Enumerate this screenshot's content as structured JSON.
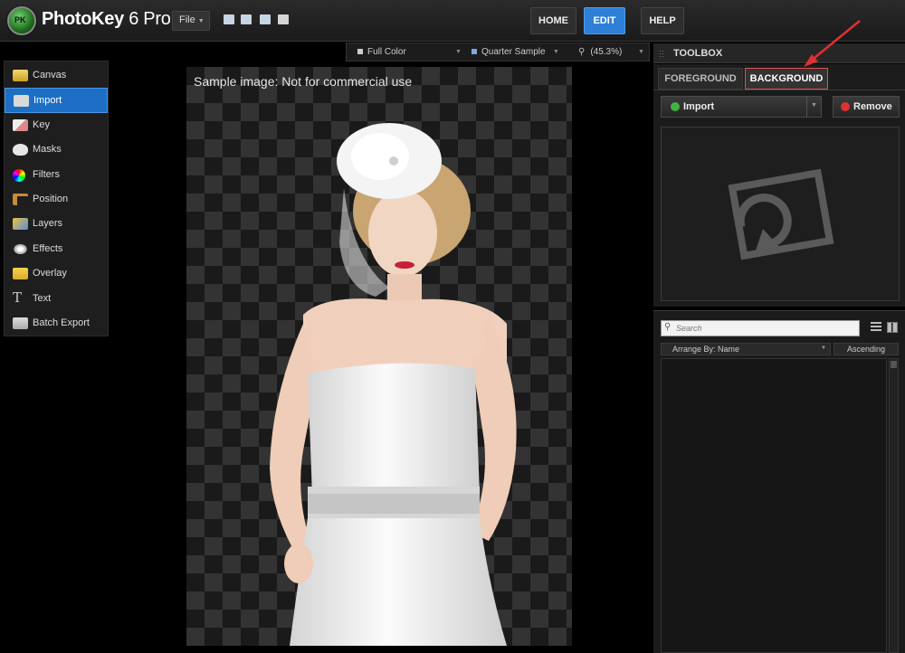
{
  "app": {
    "logo_text": "PK",
    "title": "PhotoKey",
    "version": "6 Pro"
  },
  "topbar": {
    "file_label": "File",
    "nav": [
      {
        "label": "HOME"
      },
      {
        "label": "EDIT"
      },
      {
        "label": "HELP"
      }
    ],
    "active_nav": "EDIT"
  },
  "sidebar": {
    "items": [
      {
        "label": "Canvas",
        "icon": "canvas-icon"
      },
      {
        "label": "Import",
        "icon": "import-icon"
      },
      {
        "label": "Key",
        "icon": "key-icon"
      },
      {
        "label": "Masks",
        "icon": "masks-icon"
      },
      {
        "label": "Filters",
        "icon": "filters-icon"
      },
      {
        "label": "Position",
        "icon": "position-icon"
      },
      {
        "label": "Layers",
        "icon": "layers-icon"
      },
      {
        "label": "Effects",
        "icon": "effects-icon"
      },
      {
        "label": "Overlay",
        "icon": "overlay-icon"
      },
      {
        "label": "Text",
        "icon": "text-icon"
      },
      {
        "label": "Batch Export",
        "icon": "batch-export-icon"
      }
    ],
    "active": "Import"
  },
  "canvas": {
    "color_mode": "Full Color",
    "sample_mode": "Quarter Sample",
    "zoom": "(45.3%)",
    "watermark": "Sample image: Not for commercial use"
  },
  "toolbox": {
    "title": "TOOLBOX",
    "tabs": [
      {
        "label": "FOREGROUND"
      },
      {
        "label": "BACKGROUND"
      }
    ],
    "active_tab": "BACKGROUND",
    "import_label": "Import",
    "remove_label": "Remove",
    "search_placeholder": "Search",
    "arrange_label": "Arrange By: Name",
    "sort_label": "Ascending"
  },
  "colors": {
    "accent": "#2f7fd6",
    "highlight_red": "#e03030",
    "panel_bg": "#1b1b1b"
  }
}
